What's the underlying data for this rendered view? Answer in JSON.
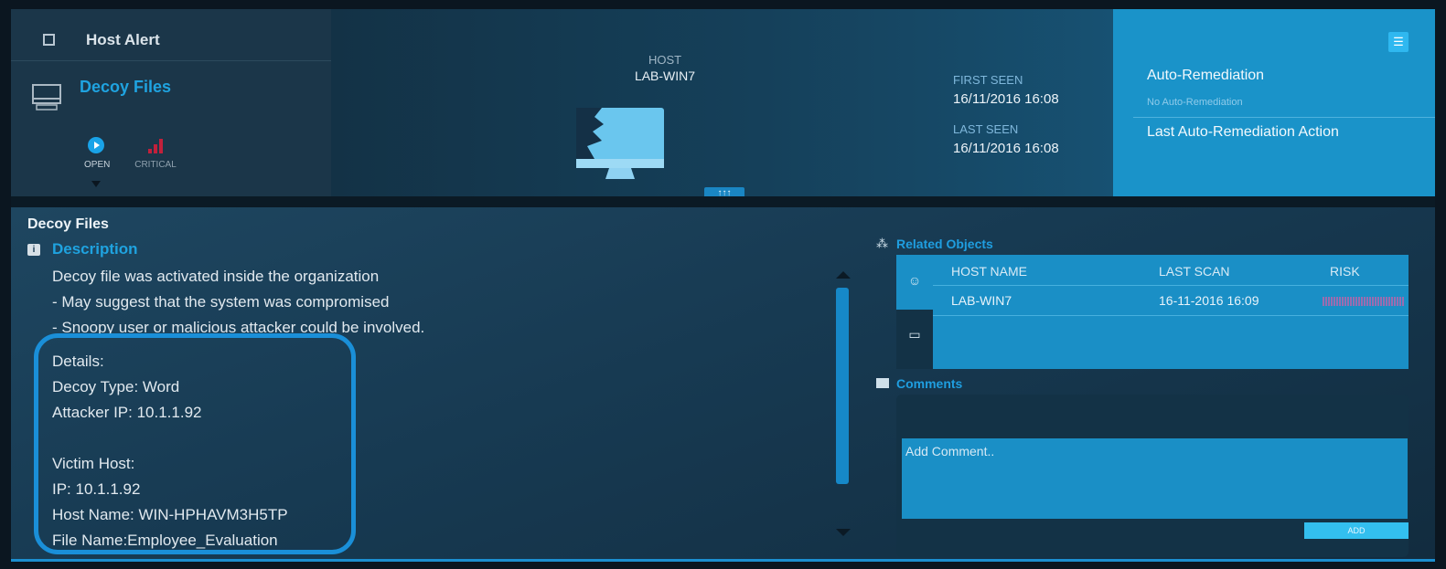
{
  "header": {
    "title": "Host Alert",
    "alert_name": "Decoy Files",
    "status_open": "OPEN",
    "status_severity": "CRITICAL",
    "host_label": "HOST",
    "host_value": "LAB-WIN7",
    "expand_label": "↑↑↑",
    "first_seen_label": "FIRST SEEN",
    "first_seen_value": "16/11/2016 16:08",
    "last_seen_label": "LAST SEEN",
    "last_seen_value": "16/11/2016 16:08",
    "auto_remediation_title": "Auto-Remediation",
    "auto_remediation_value": "No Auto-Remediation",
    "last_action_title": "Last Auto-Remediation Action",
    "severity_color": "#c1203b",
    "accent": "#1fa3e0"
  },
  "details": {
    "section_title": "Decoy Files",
    "description_title": "Description",
    "description_text": "Decoy file was activated inside the organization\n- May suggest that the system was compromised\n- Snoopy user or malicious attacker could be involved.",
    "details_text": "Details:\nDecoy Type: Word\nAttacker IP: 10.1.1.92\n\nVictim Host:\nIP: 10.1.1.92\nHost Name: WIN-HPHAVM3H5TP\nFile Name:Employee_Evaluation"
  },
  "related": {
    "title": "Related Objects",
    "columns": [
      "HOST NAME",
      "LAST SCAN",
      "RISK"
    ],
    "rows": [
      {
        "host_name": "LAB-WIN7",
        "last_scan": "16-11-2016 16:09",
        "risk": "high"
      }
    ]
  },
  "comments": {
    "title": "Comments",
    "placeholder": "Add Comment..",
    "add_label": "ADD"
  },
  "icons": [
    "checkbox-icon",
    "monitor-icon",
    "play-icon",
    "signal-bars-icon",
    "list-icon",
    "info-icon",
    "network-icon",
    "users-icon",
    "comment-icon"
  ]
}
